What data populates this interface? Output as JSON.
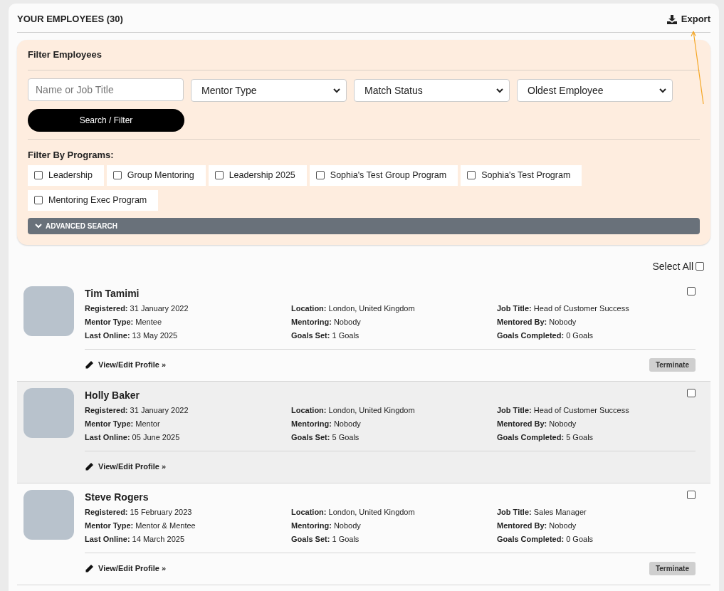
{
  "header": {
    "title": "YOUR EMPLOYEES (30)",
    "export": "Export"
  },
  "filter": {
    "title": "Filter Employees",
    "search": {
      "placeholder": "Name or Job Title"
    },
    "dropdowns": [
      "Mentor Type",
      "Match Status",
      "Oldest Employee"
    ],
    "button": "Search / Filter",
    "programs_label": "Filter By Programs:",
    "programs": [
      {
        "label": "Leadership",
        "checked": false
      },
      {
        "label": "Group Mentoring",
        "checked": false
      },
      {
        "label": "Leadership 2025",
        "checked": false
      },
      {
        "label": "Sophia's Test Group Program",
        "checked": false
      },
      {
        "label": "Sophia's Test Program",
        "checked": false
      },
      {
        "label": "Mentoring Exec Program",
        "checked": false
      }
    ],
    "advanced": "ADVANCED SEARCH"
  },
  "select_all": {
    "label": "Select All",
    "checked": false
  },
  "employees": [
    {
      "name": "Tim Tamimi",
      "highlighted": false,
      "checked": false,
      "fields": [
        {
          "label": "Registered:",
          "value": "31 January 2022"
        },
        {
          "label": "Location:",
          "value": "London, United Kingdom"
        },
        {
          "label": "Job Title:",
          "value": "Head of Customer Success"
        },
        {
          "label": "Mentor Type:",
          "value": "Mentee"
        },
        {
          "label": "Mentoring:",
          "value": "Nobody"
        },
        {
          "label": "Mentored By:",
          "value": "Nobody"
        },
        {
          "label": "Last Online:",
          "value": "13 May 2025"
        },
        {
          "label": "Goals Set:",
          "value": "1 Goals"
        },
        {
          "label": "Goals Completed:",
          "value": "0 Goals"
        }
      ],
      "link": "View/Edit Profile »",
      "action": "Terminate"
    },
    {
      "name": "Holly Baker",
      "highlighted": true,
      "checked": false,
      "fields": [
        {
          "label": "Registered:",
          "value": "31 January 2022"
        },
        {
          "label": "Location:",
          "value": "London, United Kingdom"
        },
        {
          "label": "Job Title:",
          "value": "Head of Customer Success"
        },
        {
          "label": "Mentor Type:",
          "value": "Mentor"
        },
        {
          "label": "Mentoring:",
          "value": "Nobody"
        },
        {
          "label": "Mentored By:",
          "value": "Nobody"
        },
        {
          "label": "Last Online:",
          "value": "05 June 2025"
        },
        {
          "label": "Goals Set:",
          "value": "5 Goals"
        },
        {
          "label": "Goals Completed:",
          "value": "5 Goals"
        }
      ],
      "link": "View/Edit Profile »"
    },
    {
      "name": "Steve Rogers",
      "highlighted": false,
      "checked": false,
      "fields": [
        {
          "label": "Registered:",
          "value": "15 February 2023"
        },
        {
          "label": "Location:",
          "value": "London, United Kingdom"
        },
        {
          "label": "Job Title:",
          "value": "Sales Manager"
        },
        {
          "label": "Mentor Type:",
          "value": "Mentor & Mentee"
        },
        {
          "label": "Mentoring:",
          "value": "Nobody"
        },
        {
          "label": "Mentored By:",
          "value": "Nobody"
        },
        {
          "label": "Last Online:",
          "value": "14 March 2025"
        },
        {
          "label": "Goals Set:",
          "value": "1 Goals"
        },
        {
          "label": "Goals Completed:",
          "value": "0 Goals"
        }
      ],
      "link": "View/Edit Profile »",
      "action": "Terminate"
    }
  ]
}
